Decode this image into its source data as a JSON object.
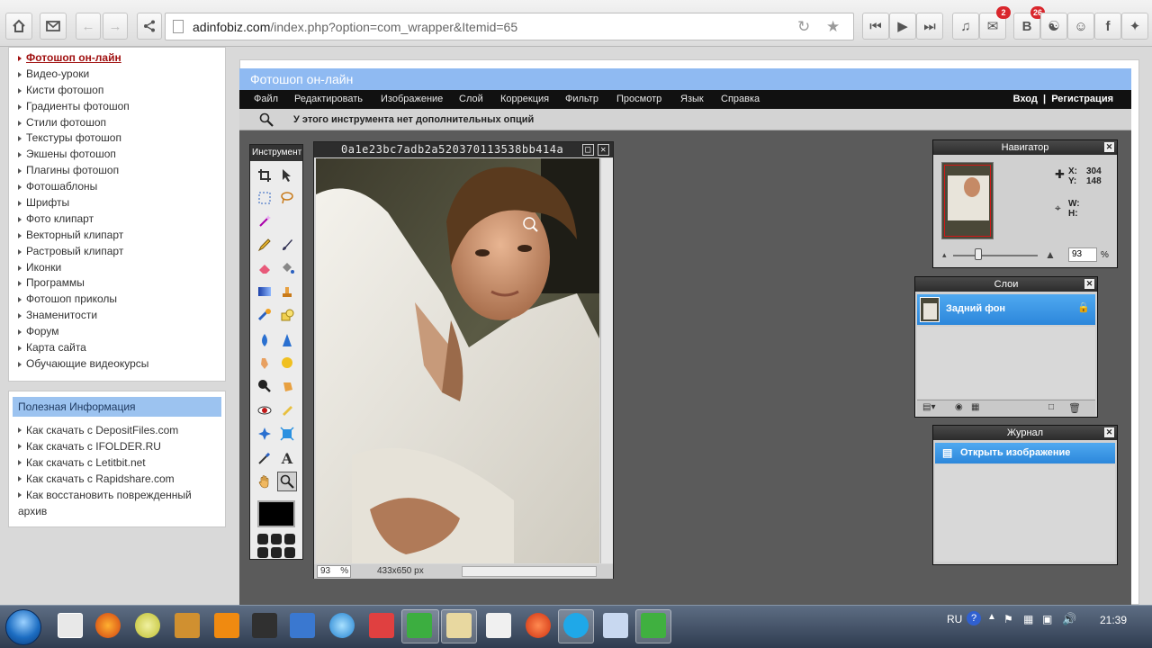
{
  "browser": {
    "url_host": "adinfobiz.com",
    "url_path": "/index.php?option=com_wrapper&Itemid=65",
    "notif_badge_1": "2",
    "notif_badge_2": "26"
  },
  "sidebar": {
    "menu": [
      "Фотошоп он-лайн",
      "Видео-уроки",
      "Кисти фотошоп",
      "Градиенты фотошоп",
      "Стили фотошоп",
      "Текстуры фотошоп",
      "Экшены фотошоп",
      "Плагины фотошоп",
      "Фотошаблоны",
      "Шрифты",
      "Фото клипарт",
      "Векторный клипарт",
      "Растровый клипарт",
      "Иконки",
      "Программы",
      "Фотошоп приколы",
      "Знаменитости",
      "Форум",
      "Карта сайта",
      "Обучающие видеокурсы"
    ],
    "info_title": "Полезная Информация",
    "info_links": [
      "Как скачать с DepositFiles.com",
      "Как скачать с IFOLDER.RU",
      "Как скачать с Letitbit.net",
      "Как скачать с Rapidshare.com",
      "Как восстановить поврежденный"
    ],
    "info_link_cont": "архив"
  },
  "editor": {
    "title": "Фотошоп он-лайн",
    "menu": [
      "Файл",
      "Редактировать",
      "Изображение",
      "Слой",
      "Коррекция",
      "Фильтр",
      "Просмотр",
      "Язык",
      "Справка"
    ],
    "login": "Вход",
    "separator": "|",
    "register": "Регистрация",
    "tool_hint": "У этого инструмента нет дополнительных опций",
    "tools_title": "Инструмент",
    "document": {
      "title": "0a1e23bc7adb2a520370113538bb414a",
      "zoom": "93",
      "zoom_unit": "%",
      "size": "433x650 px"
    },
    "navigator": {
      "title": "Навигатор",
      "x_label": "X:",
      "x_value": "304",
      "y_label": "Y:",
      "y_value": "148",
      "w_label": "W:",
      "h_label": "H:",
      "zoom": "93",
      "zoom_unit": "%"
    },
    "layers": {
      "title": "Слои",
      "layer_name": "Задний фон"
    },
    "history": {
      "title": "Журнал",
      "item": "Открыть изображение"
    }
  },
  "taskbar": {
    "lang": "RU",
    "time": "21:39"
  },
  "colors": {
    "title_blue": "#8fbaf2",
    "selection_blue": "#2c87db",
    "active_link": "#a01010"
  }
}
